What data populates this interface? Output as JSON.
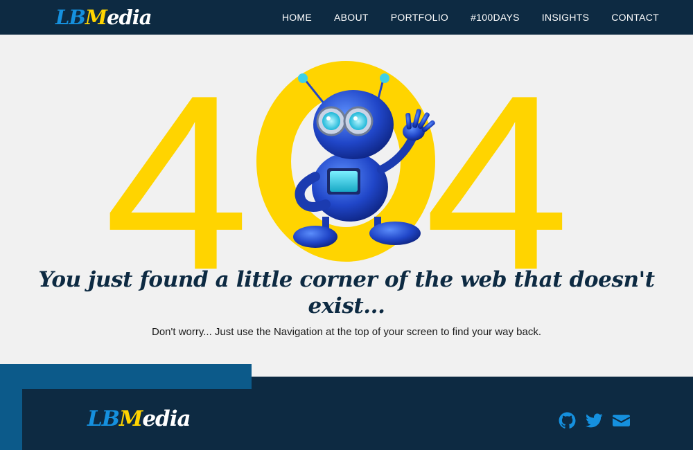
{
  "header": {
    "logo": {
      "lb": "LB",
      "m": "M",
      "rest": "edia"
    },
    "nav": [
      "HOME",
      "ABOUT",
      "PORTFOLIO",
      "#100DAYS",
      "INSIGHTS",
      "CONTACT"
    ]
  },
  "hero": {
    "digit_left": "4",
    "digit_right": "4"
  },
  "message": {
    "line1": "You just found a little corner of the web that doesn't",
    "line2": "exist...",
    "subtext": "Don't worry... Just use the Navigation at the top of your screen to find your way back."
  },
  "footer": {
    "logo": {
      "lb": "LB",
      "m": "M",
      "rest": "edia"
    },
    "social_icons": [
      "github-icon",
      "twitter-icon",
      "envelope-icon"
    ]
  },
  "colors": {
    "navy": "#0d2a42",
    "accent_blue": "#1590de",
    "yellow": "#ffd400",
    "footer_accent": "#0c5a8a",
    "background": "#f1f1f1"
  }
}
